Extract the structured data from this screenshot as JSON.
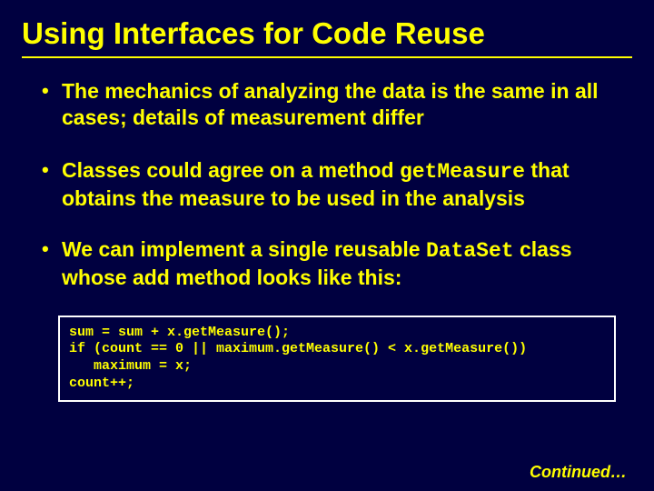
{
  "title": "Using Interfaces for Code Reuse",
  "bullets": [
    {
      "pre": "The mechanics of analyzing the data is the same in all cases; details of measurement differ",
      "mono": "",
      "post": ""
    },
    {
      "pre": "Classes could agree on a method ",
      "mono": "getMeasure",
      "post": " that obtains the measure to be used in the analysis"
    },
    {
      "pre": "We can implement a single reusable ",
      "mono": "DataSet",
      "post": " class whose add method looks like this:"
    }
  ],
  "code": "sum = sum + x.getMeasure();\nif (count == 0 || maximum.getMeasure() < x.getMeasure())\n   maximum = x;\ncount++;",
  "continued": "Continued…"
}
